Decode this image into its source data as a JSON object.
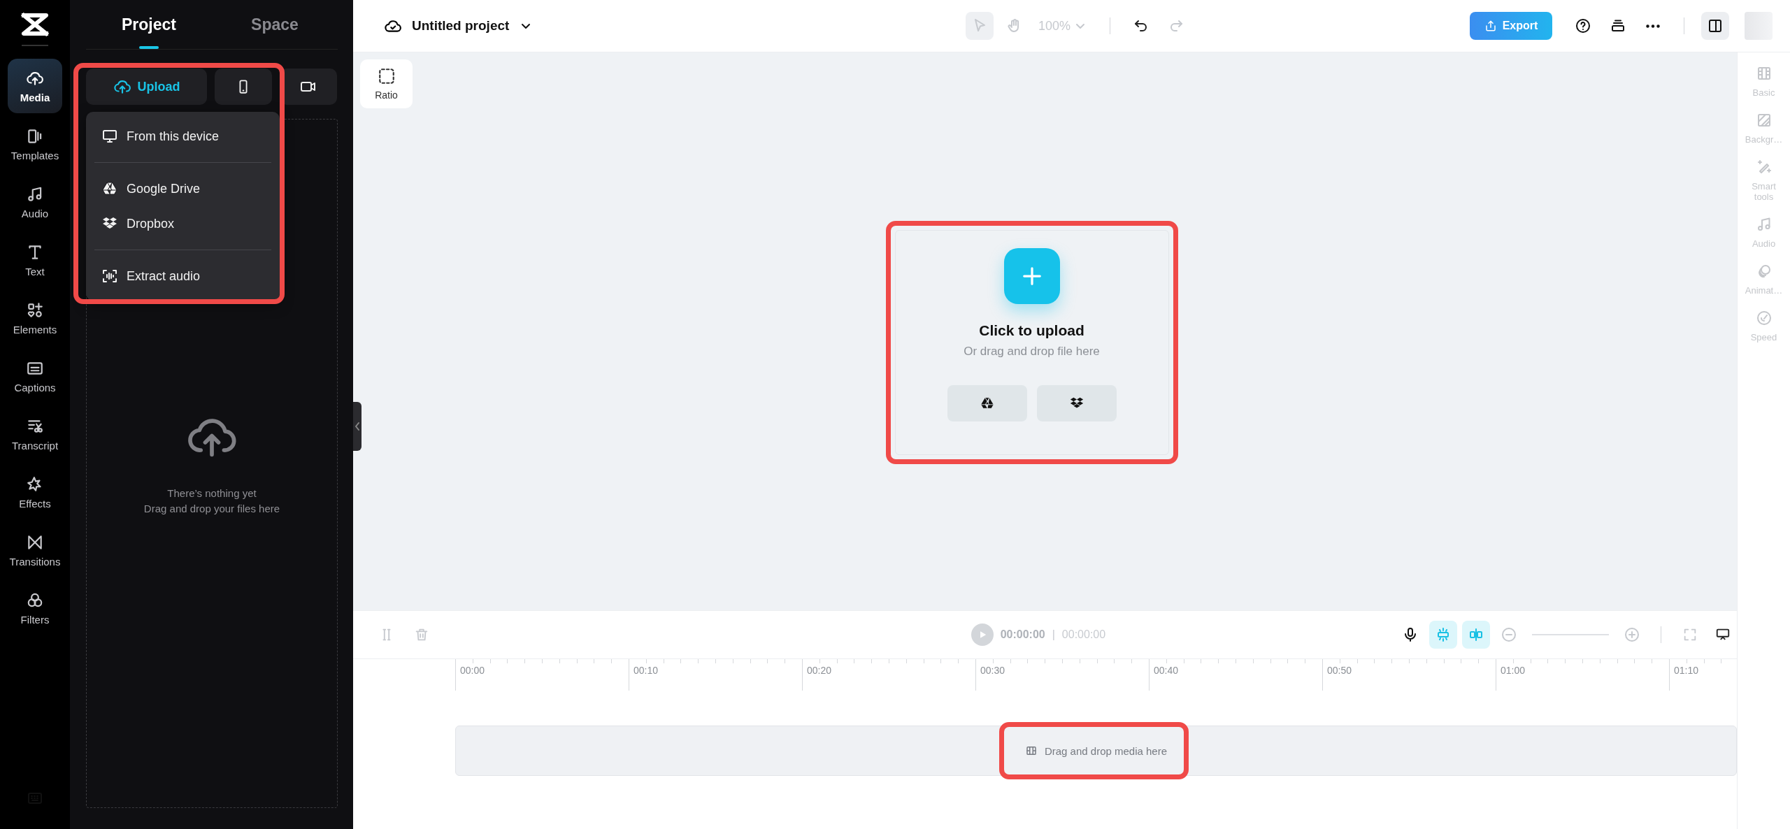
{
  "rail": {
    "items": [
      {
        "label": "Media",
        "selected": true
      },
      {
        "label": "Templates",
        "selected": false
      },
      {
        "label": "Audio",
        "selected": false
      },
      {
        "label": "Text",
        "selected": false
      },
      {
        "label": "Elements",
        "selected": false
      },
      {
        "label": "Captions",
        "selected": false
      },
      {
        "label": "Transcript",
        "selected": false
      },
      {
        "label": "Effects",
        "selected": false
      },
      {
        "label": "Transitions",
        "selected": false
      },
      {
        "label": "Filters",
        "selected": false
      }
    ]
  },
  "panel": {
    "tabs": [
      {
        "label": "Project",
        "selected": true
      },
      {
        "label": "Space",
        "selected": false
      }
    ],
    "upload_button": {
      "label": "Upload"
    },
    "upload_menu": {
      "highlighted": true,
      "groups": [
        [
          {
            "label": "From this device"
          }
        ],
        [
          {
            "label": "Google Drive"
          },
          {
            "label": "Dropbox"
          }
        ],
        [
          {
            "label": "Extract audio"
          }
        ]
      ]
    },
    "empty_state": {
      "lines": [
        "There’s nothing yet",
        "Drag and drop your files here"
      ]
    }
  },
  "topbar": {
    "project_title": "Untitled project",
    "canvas_tools": [
      {
        "kind": "select",
        "disabled": true
      },
      {
        "kind": "hand",
        "disabled": true
      },
      {
        "kind": "zoom",
        "label": "100%",
        "disabled": true
      },
      {
        "kind": "undo",
        "disabled": false
      },
      {
        "kind": "redo",
        "disabled": true
      }
    ],
    "export_button": "Export"
  },
  "canvas": {
    "ratio_button": "Ratio",
    "upload_card": {
      "title": "Click to upload",
      "subtitle": "Or drag and drop file here",
      "highlighted": true
    }
  },
  "right_panel": {
    "items": [
      {
        "label": "Basic",
        "disabled": true
      },
      {
        "label": "Backgr…",
        "disabled": true
      },
      {
        "label": "Smart tools",
        "disabled": true
      },
      {
        "label": "Audio",
        "disabled": true
      },
      {
        "label": "Animat…",
        "disabled": true
      },
      {
        "label": "Speed",
        "disabled": true
      }
    ]
  },
  "timeline": {
    "current_time": "00:00:00",
    "separator": "|",
    "total_time": "00:00:00",
    "toggles": [
      {
        "on": true
      },
      {
        "on": true
      }
    ],
    "ruler": [
      "00:00",
      "00:10",
      "00:20",
      "00:30",
      "00:40",
      "00:50",
      "01:00",
      "01:10"
    ],
    "track_placeholder": {
      "label": "Drag and drop media here",
      "highlighted": true
    }
  }
}
